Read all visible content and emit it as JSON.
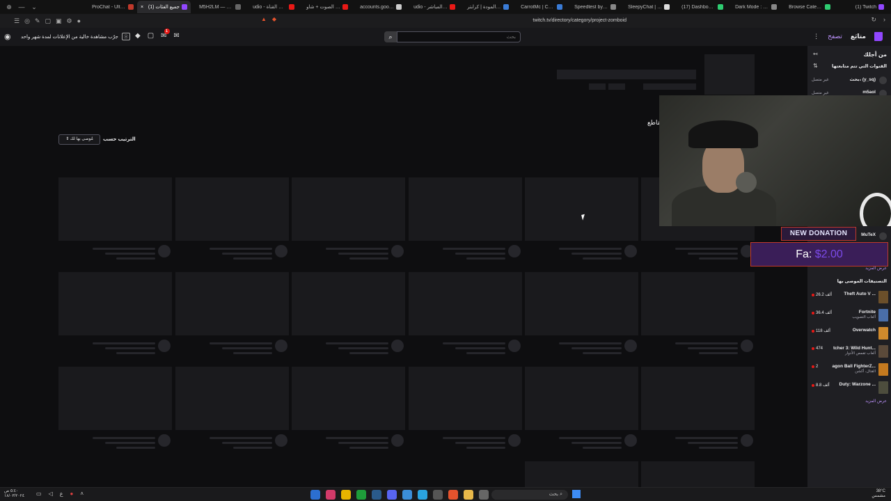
{
  "browser": {
    "tabs": [
      {
        "label": "ProChat - Ultimate",
        "color": "#c0392b",
        "active": false
      },
      {
        "label": "(1) جميع الفئات",
        "color": "#9147ff",
        "active": true
      },
      {
        "label": "M5H2LM — تف بث",
        "color": "#666666",
        "active": false
      },
      {
        "label": "udio - محتوى القناة",
        "color": "#e91916",
        "active": false
      },
      {
        "label": "تزالس الصوت + شاو",
        "color": "#e91916",
        "active": false
      },
      {
        "label": "accounts.google.co",
        "color": "#cccccc",
        "active": false
      },
      {
        "label": "udio - البث المباشر",
        "color": "#e91916",
        "active": false
      },
      {
        "label": "الرابط المودة | كرابتر",
        "color": "#3a7bd5",
        "active": false
      },
      {
        "label": "CarrotMc | Console",
        "color": "#3a7bd5",
        "active": false
      },
      {
        "label": "Speedtest by Ookla",
        "color": "#888888",
        "active": false
      },
      {
        "label": "SleepyChat | Multi",
        "color": "#dddddd",
        "active": false
      },
      {
        "label": "(17) Dashboard / S",
        "color": "#2ecc71",
        "active": false
      },
      {
        "label": "Dark Mode : MyBro",
        "color": "#888888",
        "active": false
      },
      {
        "label": "Browse Categories",
        "color": "#2ecc71",
        "active": false
      },
      {
        "label": "(1) Twitch",
        "color": "#9147ff",
        "active": false
      }
    ],
    "url": "twitch.tv/directory/category/project-zomboid"
  },
  "topnav": {
    "promo_text": "جرّب مشاهدة خالية من الإعلانات لمدة شهر واحد",
    "notif_count": "1",
    "search_placeholder": "بحث",
    "browse_label": "تصفح",
    "following_label": "متابَع"
  },
  "main": {
    "sort_label": "الترتيب حسب",
    "sort_value": "مُوصى بها لك",
    "clips_label": "مقاطع"
  },
  "sidebar": {
    "for_you": "من أجلك",
    "followed_header": "القنوات التي تتم متابعتها",
    "channels": [
      {
        "name": "بحث، (y_sq)",
        "status": "غير متصل"
      },
      {
        "name": "m5aol",
        "status": "غير متصل"
      }
    ],
    "partial_channel": "MuTeX",
    "show_more_1": "عرض المزيد",
    "recommended_header": "التصنيفات الموصى بها",
    "categories": [
      {
        "name": "Theft Auto V ...",
        "tag": "",
        "viewers": "26.2 ألف",
        "thumb": "#6b4f2a"
      },
      {
        "name": "Fortnite",
        "tag": "ألعاب التصويب",
        "viewers": "36.4 ألف",
        "thumb": "#4a6ea8"
      },
      {
        "name": "Overwatch",
        "tag": "",
        "viewers": "118 ألف",
        "thumb": "#d08a2c"
      },
      {
        "name": "tcher 3: Wild Hunt...",
        "tag": "ألعاب تقمص الأدوار",
        "viewers": "474",
        "thumb": "#5b4a3a"
      },
      {
        "name": "agon Ball FighterZ...",
        "tag": "القتال، أكشن",
        "viewers": "2",
        "thumb": "#c47a1f"
      },
      {
        "name": "Duty: Warzone ...",
        "tag": "",
        "viewers": "8.8 ألف",
        "thumb": "#4d4d3d"
      }
    ],
    "show_more_2": "عرض المزيد"
  },
  "donation": {
    "title": "NEW DONATION",
    "donor": "Fa:",
    "amount": "$2.00"
  },
  "taskbar": {
    "time": "٥:٤٠ ص",
    "date": "١٨/٠٣/٢٠٢٤",
    "search_label": "بحث",
    "temp": "38°C",
    "weather": "مشمس"
  }
}
